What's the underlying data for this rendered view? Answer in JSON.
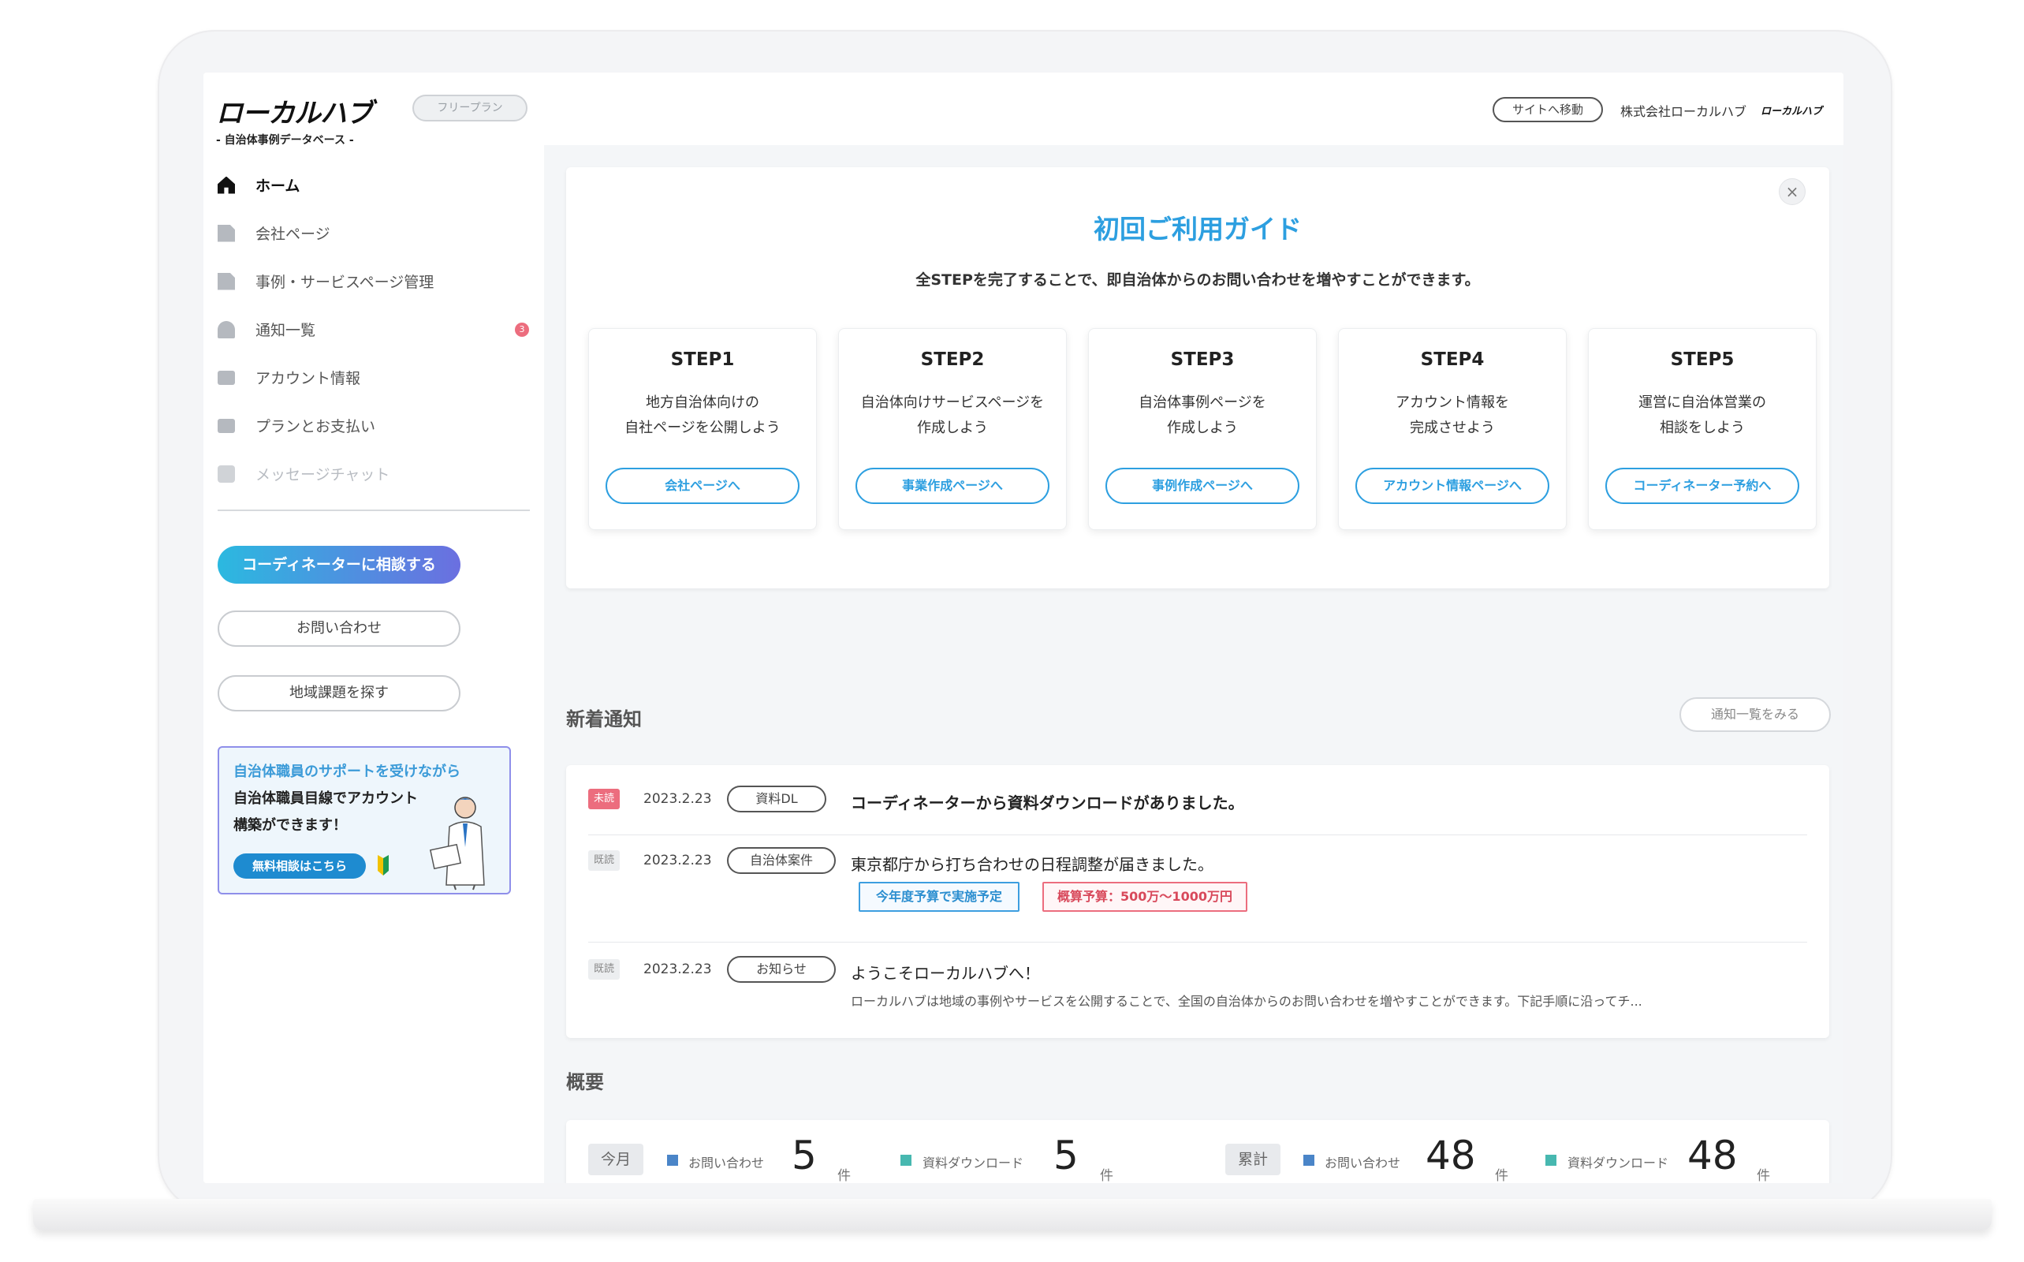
{
  "header": {
    "logo_main": "ローカルハブ",
    "logo_sub": "- 自治体事例データベース -",
    "plan_badge": "フリープラン",
    "site_link": "サイトへ移動",
    "company_name": "株式会社ローカルハブ",
    "mini_logo": "ローカルハブ"
  },
  "sidebar": {
    "items": [
      {
        "label": "ホーム",
        "icon": "home-icon",
        "state": "active"
      },
      {
        "label": "会社ページ",
        "icon": "document-edit-icon",
        "state": "normal"
      },
      {
        "label": "事例・サービスページ管理",
        "icon": "document-add-icon",
        "state": "normal"
      },
      {
        "label": "通知一覧",
        "icon": "bell-icon",
        "state": "normal",
        "badge": "3"
      },
      {
        "label": "アカウント情報",
        "icon": "id-card-icon",
        "state": "normal"
      },
      {
        "label": "プランとお支払い",
        "icon": "credit-card-icon",
        "state": "normal"
      },
      {
        "label": "メッセージチャット",
        "icon": "chat-icon",
        "state": "disabled"
      }
    ],
    "cta_consult": "コーディネーターに相談する",
    "contact": "お問い合わせ",
    "search_issues": "地域課題を探す",
    "promo": {
      "line1": "自治体職員のサポートを受けながら",
      "line2": "自治体職員目線でアカウント",
      "line3": "構築ができます！",
      "button": "無料相談はこちら"
    }
  },
  "guide": {
    "title": "初回ご利用ガイド",
    "subtitle": "全STEPを完了することで、即自治体からのお問い合わせを増やすことができます。",
    "close": "×",
    "steps": [
      {
        "title": "STEP1",
        "desc1": "地方自治体向けの",
        "desc2": "自社ページを公開しよう",
        "button": "会社ページへ"
      },
      {
        "title": "STEP2",
        "desc1": "自治体向けサービスページを",
        "desc2": "作成しよう",
        "button": "事業作成ページへ"
      },
      {
        "title": "STEP3",
        "desc1": "自治体事例ページを",
        "desc2": "作成しよう",
        "button": "事例作成ページへ"
      },
      {
        "title": "STEP4",
        "desc1": "アカウント情報を",
        "desc2": "完成させよう",
        "button": "アカウント情報ページへ"
      },
      {
        "title": "STEP5",
        "desc1": "運営に自治体営業の",
        "desc2": "相談をしよう",
        "button": "コーディネーター予約へ"
      }
    ]
  },
  "notifications": {
    "title": "新着通知",
    "view_all": "通知一覧をみる",
    "items": [
      {
        "status": "未読",
        "date": "2023.2.23",
        "category": "資料DL",
        "text": "コーディネーターから資料ダウンロードがありました。"
      },
      {
        "status": "既読",
        "date": "2023.2.23",
        "category": "自治体案件",
        "text": "東京都庁から打ち合わせの日程調整が届きました。",
        "chips": [
          "今年度予算で実施予定",
          "概算予算：500万〜1000万円"
        ]
      },
      {
        "status": "既読",
        "date": "2023.2.23",
        "category": "お知らせ",
        "text": "ようこそローカルハブへ！",
        "sub": "ローカルハブは地域の事例やサービスを公開することで、全国の自治体からのお問い合わせを増やすことができます。下記手順に沿ってチ..."
      }
    ]
  },
  "summary": {
    "title": "概要",
    "this_month": {
      "label": "今月",
      "inquiries_label": "お問い合わせ",
      "inquiries": "5",
      "downloads_label": "資料ダウンロード",
      "downloads": "5",
      "unit": "件"
    },
    "total": {
      "label": "累計",
      "inquiries_label": "お問い合わせ",
      "inquiries": "48",
      "downloads_label": "資料ダウンロード",
      "downloads": "48",
      "unit": "件"
    }
  },
  "colors": {
    "accent": "#2d9fe0",
    "unread": "#ec6d7e",
    "gradient_start": "#2bb9e0",
    "gradient_end": "#6b6fe0"
  }
}
